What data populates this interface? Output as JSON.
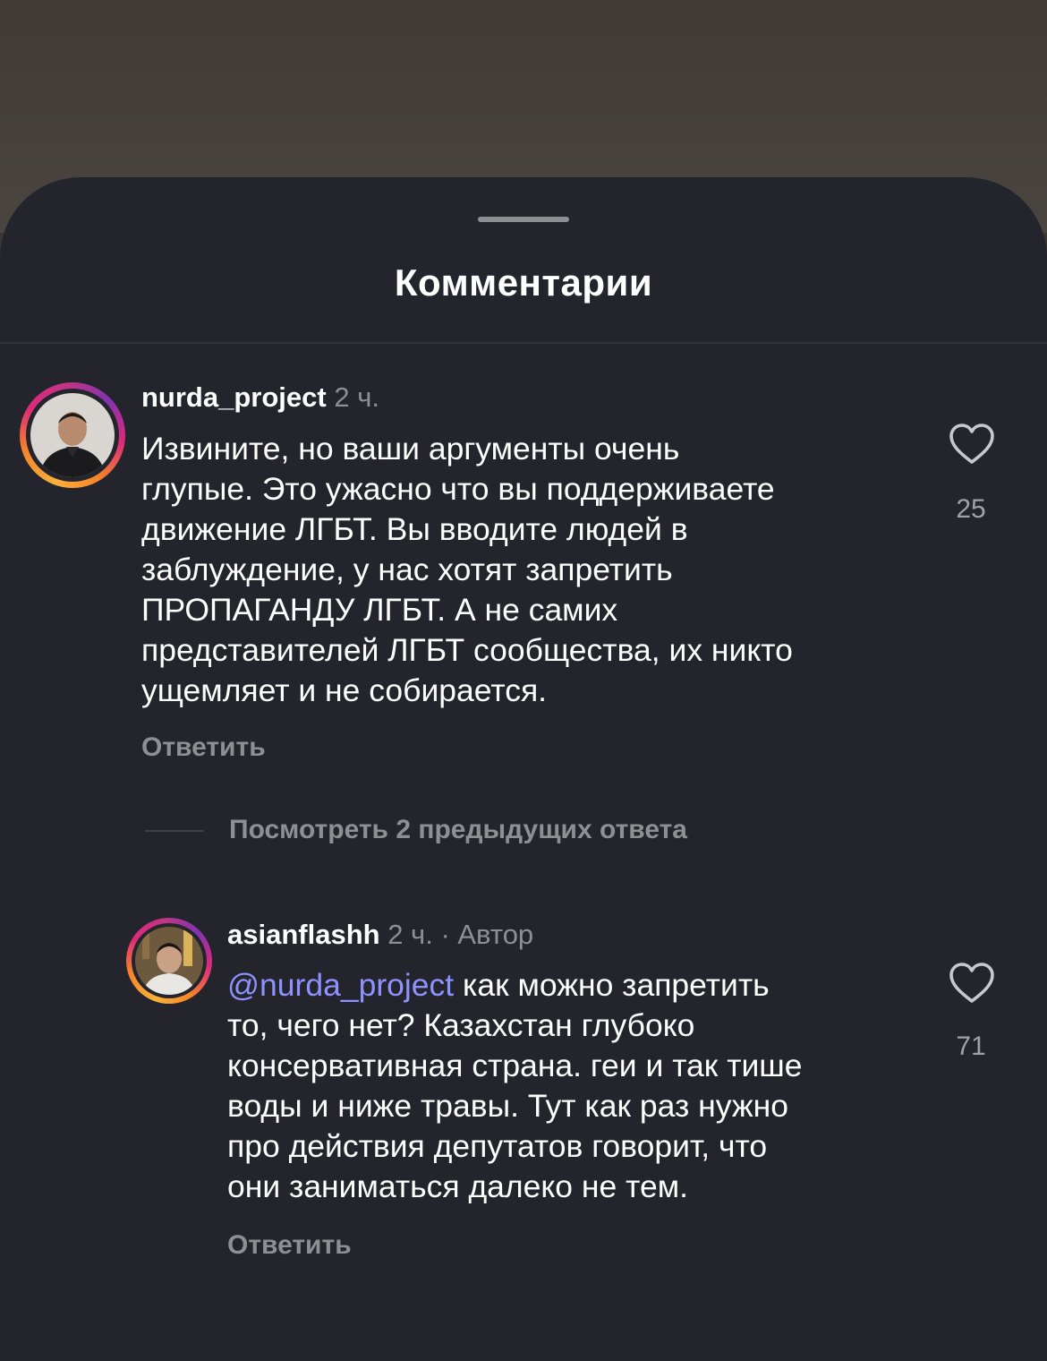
{
  "sheet": {
    "title": "Комментарии"
  },
  "comments": [
    {
      "username": "nurda_project",
      "time": "2 ч.",
      "text": "Извините, но ваши аргументы очень глупые. Это ужасно что вы поддерживаете движение ЛГБТ. Вы вводите людей в заблуждение, у нас хотят запретить ПРОПАГАНДУ ЛГБТ. А не самих представителей ЛГБТ сообщества, их никто ущемляет и не собирается.",
      "text_lines": [
        "Извините, но ваши аргументы очень",
        "глупые. Это ужасно что вы поддерживаете",
        "движение ЛГБТ. Вы вводите людей в",
        "заблуждение, у нас хотят запретить",
        "ПРОПАГАНДУ ЛГБТ. А не самих",
        "представителей ЛГБТ сообщества, их никто",
        "ущемляет и не собирается."
      ],
      "reply_label": "Ответить",
      "likes": "25",
      "like_icon": "heart-outline-icon",
      "view_replies_label": "Посмотреть 2 предыдущих ответа"
    },
    {
      "username": "asianflashh",
      "time": "2 ч.",
      "author_tag": "· Автор",
      "mention": "@nurda_project",
      "text_after_mention": "как можно запретить то, чего нет? Казахстан глубоко консервативная страна. геи и так тише воды и ниже травы. Тут как раз нужно про действия депутатов говорит, что они заниматься далеко не тем.",
      "text_lines_after_first": [
        "то, чего нет? Казахстан глубоко",
        "консервативная страна. геи и так тише",
        "воды и ниже травы. Тут как раз нужно",
        "про действия депутатов говорит, что",
        "они заниматься далеко не тем."
      ],
      "first_line_rest": "как можно запретить",
      "reply_label": "Ответить",
      "likes": "71",
      "like_icon": "heart-outline-icon"
    }
  ],
  "colors": {
    "sheet_background": "#24242d",
    "mention": "#8e92ff",
    "secondary_text": "#8e8e93"
  }
}
